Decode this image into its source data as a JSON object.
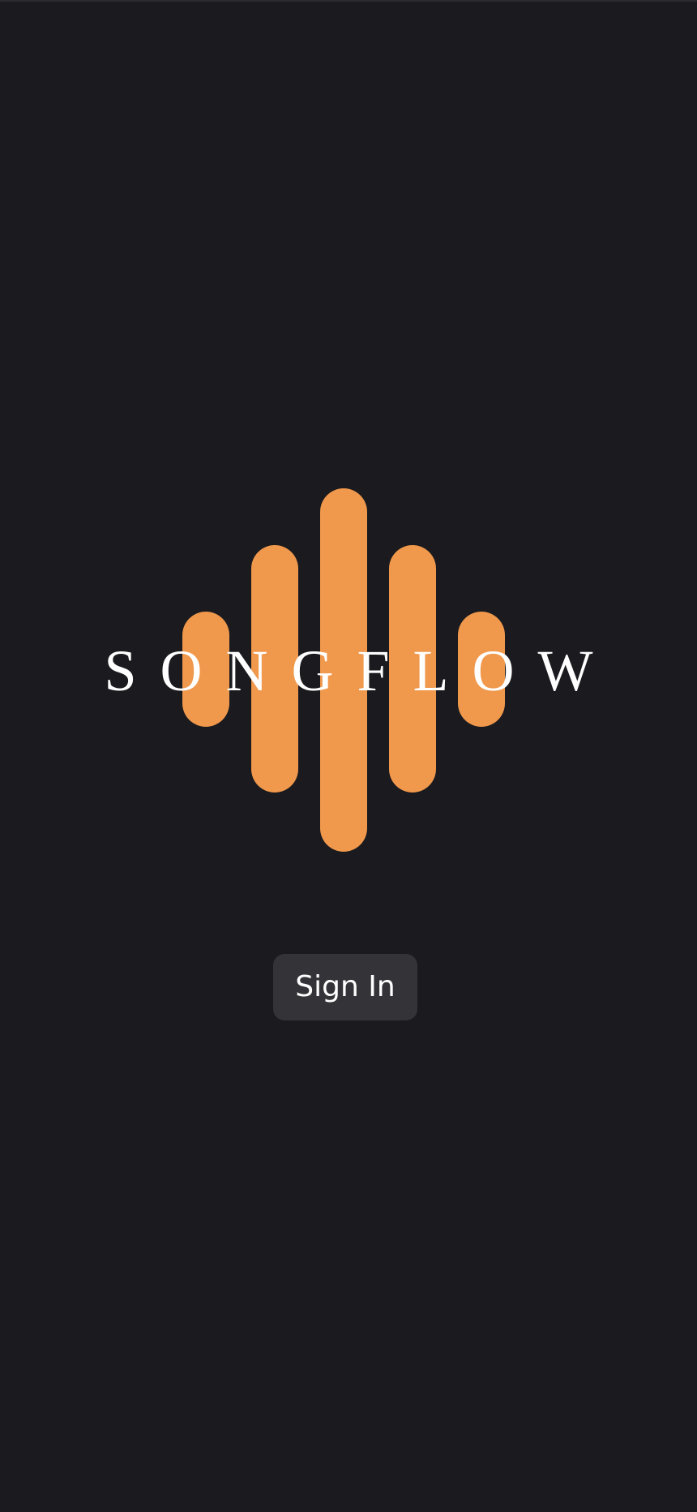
{
  "app": {
    "wordmark": "SONGFLOW",
    "logo_icon": "soundwave-bars-icon",
    "colors": {
      "background": "#1a1a1f",
      "accent": "#f0984b",
      "button_bg": "#333338",
      "text": "#ffffff"
    }
  },
  "actions": {
    "signin_label": "Sign In"
  }
}
